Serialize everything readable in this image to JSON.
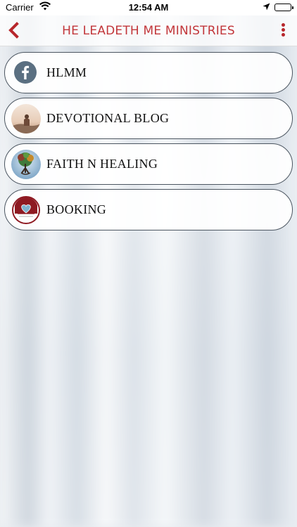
{
  "status": {
    "carrier": "Carrier",
    "time": "12:54 AM"
  },
  "nav": {
    "title": "HE LEADETH ME MINISTRIES",
    "back_icon": "chevron-left-icon",
    "more_icon": "more-vertical-icon",
    "accent": "#b7272c"
  },
  "items": [
    {
      "label": "HLMM",
      "icon": "facebook-icon"
    },
    {
      "label": "DEVOTIONAL BLOG",
      "icon": "person-on-rock-photo-icon"
    },
    {
      "label": "FAITH N HEALING",
      "icon": "tree-photo-icon"
    },
    {
      "label": "BOOKING",
      "icon": "heart-logo-icon"
    }
  ]
}
